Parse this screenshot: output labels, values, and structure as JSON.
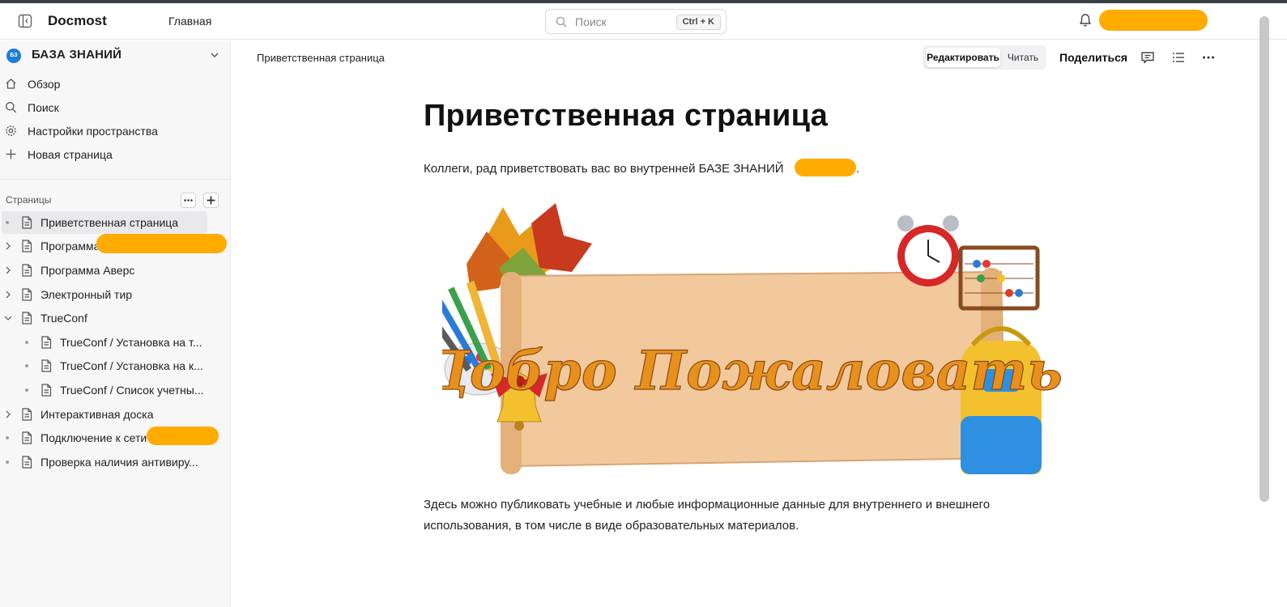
{
  "header": {
    "app_name": "Docmost",
    "home_label": "Главная",
    "search_placeholder": "Поиск",
    "search_shortcut": "Ctrl + K"
  },
  "sidebar": {
    "space_badge": "БЗ",
    "space_name": "БАЗА ЗНАНИЙ",
    "nav": [
      {
        "label": "Обзор",
        "icon": "home-icon"
      },
      {
        "label": "Поиск",
        "icon": "search-icon"
      },
      {
        "label": "Настройки пространства",
        "icon": "gear-icon"
      },
      {
        "label": "Новая страница",
        "icon": "plus-icon"
      }
    ],
    "pages_header": "Страницы",
    "tree": [
      {
        "label": "Приветственная страница",
        "active": true
      },
      {
        "label": "Программа"
      },
      {
        "label": "Программа Аверс"
      },
      {
        "label": "Электронный тир"
      },
      {
        "label": "TrueConf",
        "expanded": true
      },
      {
        "label": "TrueConf / Установка на т..."
      },
      {
        "label": "TrueConf / Установка на к..."
      },
      {
        "label": "TrueConf / Список учетны..."
      },
      {
        "label": "Интерактивная доска"
      },
      {
        "label": "Подключение к сети"
      },
      {
        "label": "Проверка наличия антивиру..."
      }
    ]
  },
  "page": {
    "breadcrumb": "Приветственная страница",
    "mode_edit": "Редактировать",
    "mode_read": "Читать",
    "share_label": "Поделиться",
    "title": "Приветственная страница",
    "intro": "Коллеги, рад приветствовать вас во внутренней БАЗЕ ЗНАНИЙ",
    "intro_end": ".",
    "banner_text": "Добро Пожаловать!",
    "body": "Здесь можно публиковать учебные и любые информационные данные для внутреннего и внешнего использования, в том числе в виде образовательных материалов."
  },
  "colors": {
    "accent": "#1c7ed6",
    "redaction": "#ffab00",
    "banner_text": "#e8901c"
  }
}
